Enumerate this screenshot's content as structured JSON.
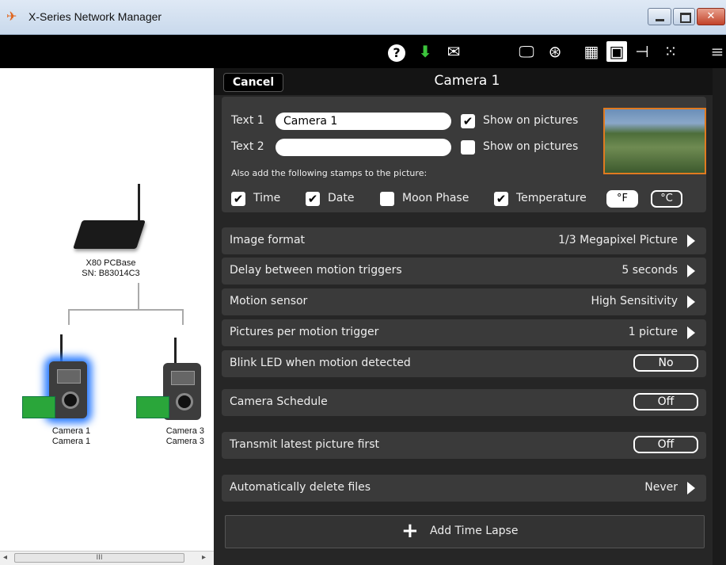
{
  "window": {
    "title": "X-Series Network Manager",
    "close_label": "✕"
  },
  "toolbar": {
    "icons": [
      "help-icon",
      "download-icon",
      "mail-icon",
      "monitor-icon",
      "film-icon",
      "screen-icon",
      "network-icon",
      "tree-icon",
      "grid-icon",
      "menu-icon"
    ],
    "help_glyph": "?",
    "download_glyph": "⬇",
    "mail_glyph": "✉",
    "monitor_glyph": "🖵",
    "film_glyph": "⊛",
    "screen_glyph": "▦",
    "network_glyph": "▣",
    "tree_glyph": "⊣",
    "grid_glyph": "⁙",
    "menu_glyph": "≡"
  },
  "left": {
    "base": {
      "name": "X80 PCBase",
      "sn": "SN: B83014C3"
    },
    "cameras": [
      {
        "line1": "Camera 1",
        "line2": "Camera 1"
      },
      {
        "line1": "Camera 3",
        "line2": "Camera 3"
      }
    ],
    "scroll_thumb": "III",
    "scroll_left": "◂",
    "scroll_right": "▸"
  },
  "panel": {
    "cancel_label": "Cancel",
    "title": "Camera 1",
    "text1_label": "Text 1",
    "text1_value": "Camera 1",
    "text2_label": "Text 2",
    "text2_value": "",
    "show_on_pictures": "Show on pictures",
    "text1_show": true,
    "text2_show": false,
    "stamps_note": "Also add the following stamps to the picture:",
    "stamps": {
      "time": "Time",
      "date": "Date",
      "moon": "Moon Phase",
      "temperature": "Temperature",
      "unit_f": "°F",
      "unit_c": "°C"
    },
    "check_glyph": "✔"
  },
  "settings": [
    {
      "label": "Image format",
      "value": "1/3 Megapixel Picture"
    },
    {
      "label": "Delay between motion triggers",
      "value": "5 seconds"
    },
    {
      "label": "Motion sensor",
      "value": "High Sensitivity"
    },
    {
      "label": "Pictures per motion trigger",
      "value": "1 picture"
    },
    {
      "label": "Blink LED when motion detected",
      "value": "No"
    },
    {
      "label": "Camera Schedule",
      "value": "Off"
    },
    {
      "label": "Transmit latest picture first",
      "value": "Off"
    },
    {
      "label": "Automatically delete files",
      "value": "Never"
    }
  ],
  "add_time_lapse": {
    "plus": "+",
    "label": "Add Time Lapse"
  },
  "colors": {
    "selected_glow": "#2a7bff",
    "accent_border": "#e07a20",
    "battery": "#2aa63a"
  }
}
